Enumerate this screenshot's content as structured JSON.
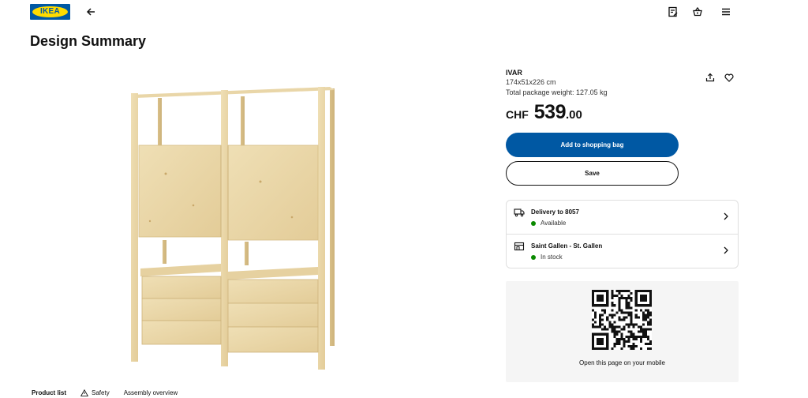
{
  "header": {
    "logo_text": "IKEA",
    "icons": [
      "back-arrow-icon",
      "shopping-list-icon",
      "shopping-bag-icon",
      "hamburger-menu-icon"
    ]
  },
  "page": {
    "title": "Design Summary"
  },
  "product": {
    "name": "IVAR",
    "dimensions": "174x51x226 cm",
    "weight": "Total package weight: 127.05 kg",
    "price": {
      "currency": "CHF",
      "main": "539",
      "decimal": ".00"
    }
  },
  "actions": {
    "add_to_bag": "Add to shopping bag",
    "save": "Save"
  },
  "availability": [
    {
      "title": "Delivery to 8057",
      "status": "Available",
      "icon": "truck-icon"
    },
    {
      "title": "Saint Gallen - St. Gallen",
      "status": "In stock",
      "icon": "store-icon"
    }
  ],
  "qr": {
    "caption": "Open this page on your mobile"
  },
  "tabs": [
    {
      "label": "Product list"
    },
    {
      "label": "Safety"
    },
    {
      "label": "Assembly overview"
    }
  ],
  "colors": {
    "brand_blue": "#0058a3",
    "brand_yellow": "#ffdb00",
    "in_stock_green": "#0a8a00"
  }
}
